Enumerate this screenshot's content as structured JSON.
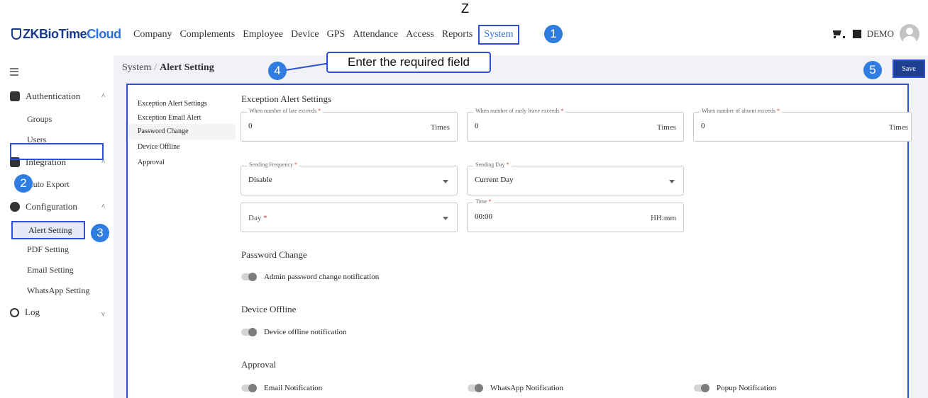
{
  "top_mark": "Z",
  "brand": {
    "logo_prefix": "ZKBioTime",
    "logo_suffix": "Cloud"
  },
  "nav": {
    "items": [
      "Company",
      "Complements",
      "Employee",
      "Device",
      "GPS",
      "Attendance",
      "Access",
      "Reports",
      "System"
    ],
    "active": "System"
  },
  "header_right": {
    "org_name": "DEMO"
  },
  "callouts": {
    "badges": [
      "1",
      "2",
      "3",
      "4",
      "5"
    ],
    "tooltip": "Enter the required field"
  },
  "sidebar": {
    "sections": [
      {
        "label": "Authentication",
        "icon": "shield-key-icon",
        "items": [
          "Groups",
          "Users"
        ]
      },
      {
        "label": "Integration",
        "icon": "integration-icon",
        "items": [
          "Auto Export"
        ]
      },
      {
        "label": "Configuration",
        "icon": "gear-icon",
        "items": [
          "Alert Setting",
          "PDF Setting",
          "Email Setting",
          "WhatsApp Setting"
        ]
      },
      {
        "label": "Log",
        "icon": "history-icon",
        "items": []
      }
    ],
    "active_item": "Alert Setting"
  },
  "breadcrumb": {
    "root": "System",
    "separator": "/",
    "current": "Alert Setting"
  },
  "save_label": "Save",
  "anchors": [
    "Exception Alert Settings",
    "Exception Email Alert",
    "Password Change",
    "Device Offline",
    "Approval"
  ],
  "exception": {
    "title": "Exception Alert Settings",
    "late_label": "When number of late exceeds",
    "late_value": "0",
    "early_label": "When number of early leave exceeds",
    "early_value": "0",
    "absent_label": "When number of absent exceeds",
    "absent_value": "0",
    "times_unit": "Times",
    "freq_label": "Sending Frequency",
    "freq_value": "Disable",
    "sendday_label": "Sending Day",
    "sendday_value": "Current Day",
    "day_placeholder": "Day",
    "time_label": "Time",
    "time_value": "00:00",
    "time_format": "HH:mm",
    "required_mark": "*"
  },
  "password_change": {
    "title": "Password Change",
    "toggle_label": "Admin password change notification"
  },
  "device_offline": {
    "title": "Device Offline",
    "toggle_label": "Device offline notification"
  },
  "approval": {
    "title": "Approval",
    "email_label": "Email Notification",
    "whatsapp_label": "WhatsApp Notification",
    "popup_label": "Popup Notification"
  },
  "colors": {
    "accent": "#2f4fd6",
    "badge": "#2f7de1",
    "save_bg": "#1e3f8f"
  }
}
